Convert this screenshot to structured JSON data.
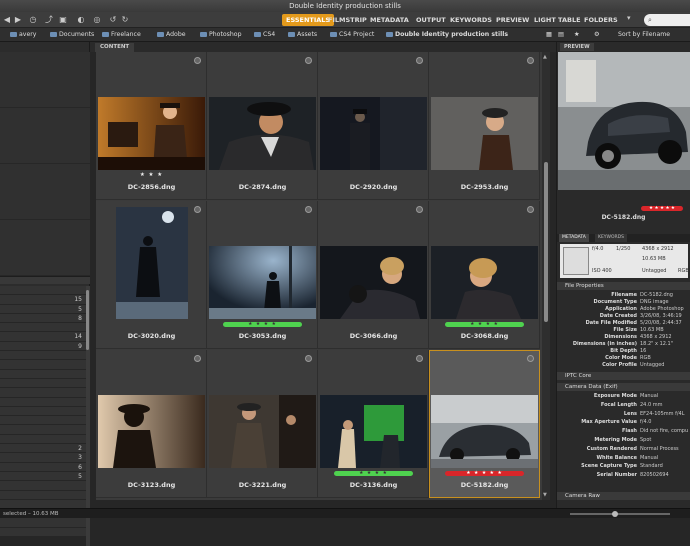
{
  "window": {
    "title": "Double Identity production stills"
  },
  "workspaces": [
    {
      "label": "ESSENTIALS",
      "active": true
    },
    {
      "label": "FILMSTRIP"
    },
    {
      "label": "METADATA"
    },
    {
      "label": "OUTPUT"
    },
    {
      "label": "KEYWORDS"
    },
    {
      "label": "PREVIEW"
    },
    {
      "label": "LIGHT TABLE"
    },
    {
      "label": "FOLDERS"
    }
  ],
  "path": [
    "avery",
    "Documents",
    "Freelance",
    "Adobe",
    "Photoshop",
    "CS4",
    "Assets",
    "CS4 Project",
    "Double Identity production stills"
  ],
  "sort_label": "Sort by Filename",
  "content_tab": "CONTENT",
  "left_counts": [
    "15",
    "5",
    "8",
    "14",
    "9",
    "2",
    "3",
    "6",
    "5"
  ],
  "thumbnails": [
    {
      "name": "DC-2856.dng",
      "stars": "★ ★ ★",
      "label": null
    },
    {
      "name": "DC-2874.dng",
      "stars": "",
      "label": null
    },
    {
      "name": "DC-2920.dng",
      "stars": "",
      "label": null
    },
    {
      "name": "DC-2953.dng",
      "stars": "",
      "label": null
    },
    {
      "name": "DC-3020.dng",
      "stars": "",
      "label": null
    },
    {
      "name": "DC-3053.dng",
      "stars": "★ ★ ★ ★",
      "label": "green"
    },
    {
      "name": "DC-3066.dng",
      "stars": "",
      "label": null
    },
    {
      "name": "DC-3068.dng",
      "stars": "★ ★ ★ ★",
      "label": "green"
    },
    {
      "name": "DC-3123.dng",
      "stars": "",
      "label": null
    },
    {
      "name": "DC-3221.dng",
      "stars": "",
      "label": null
    },
    {
      "name": "DC-3136.dng",
      "stars": "★ ★ ★ ★",
      "label": "green"
    },
    {
      "name": "DC-5182.dng",
      "stars": "★ ★ ★ ★ ★",
      "label": "red",
      "selected": true
    }
  ],
  "label_colors": {
    "green": "#4fd24f",
    "red": "#d9262a",
    "accent": "#e39a1c"
  },
  "preview": {
    "tab": "PREVIEW",
    "caption": "DC-5182.dng",
    "stars": "★ ★ ★ ★ ★"
  },
  "meta_tabs": [
    "METADATA",
    "KEYWORDS"
  ],
  "meta_box": {
    "aperture": "f/4.0",
    "shutter": "1/250",
    "dims": "4368 x 2912",
    "size": "10.63 MB",
    "iso": "ISO 400",
    "status": "Untagged",
    "mode": "RGB"
  },
  "file_properties": {
    "title": "File Properties",
    "rows": [
      [
        "Filename",
        "DC-5182.dng"
      ],
      [
        "Document Type",
        "DNG image"
      ],
      [
        "Application",
        "Adobe Photoshop"
      ],
      [
        "Date Created",
        "3/26/08, 3:46:19"
      ],
      [
        "Date File Modified",
        "5/20/08, 2:44:37"
      ],
      [
        "File Size",
        "10.63 MB"
      ],
      [
        "Dimensions",
        "4368 x 2912"
      ],
      [
        "Dimensions (in inches)",
        "18.2\" x 12.1\""
      ],
      [
        "Bit Depth",
        "16"
      ],
      [
        "Color Mode",
        "RGB"
      ],
      [
        "Color Profile",
        "Untagged"
      ]
    ]
  },
  "iptc": {
    "title": "IPTC Core"
  },
  "camera_data": {
    "title": "Camera Data (Exif)",
    "rows": [
      [
        "Exposure Mode",
        "Manual"
      ],
      [
        "Focal Length",
        "24.0 mm"
      ],
      [
        "Lens",
        "EF24-105mm f/4L"
      ],
      [
        "Max Aperture Value",
        "f/4.0"
      ],
      [
        "Flash",
        "Did not fire, compu"
      ],
      [
        "Metering Mode",
        "Spot"
      ],
      [
        "Custom Rendered",
        "Normal Process"
      ],
      [
        "White Balance",
        "Manual"
      ],
      [
        "Scene Capture Type",
        "Standard"
      ],
      [
        "Serial Number",
        "820502694"
      ]
    ]
  },
  "camera_raw": {
    "title": "Camera Raw"
  },
  "status": {
    "text": "selected – 10.63 MB"
  },
  "search": {
    "placeholder": ""
  }
}
